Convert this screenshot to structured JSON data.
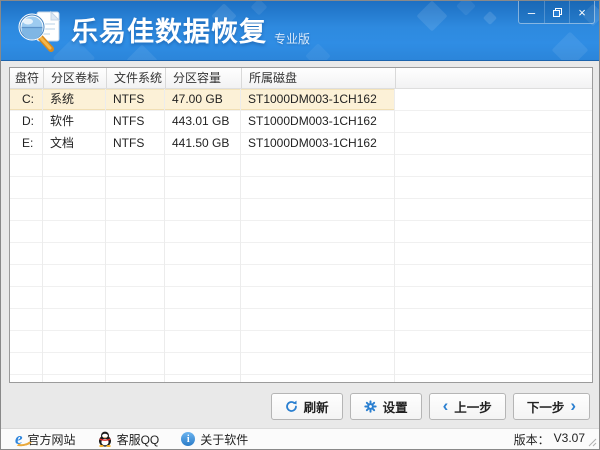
{
  "window": {
    "title": "乐易佳数据恢复",
    "edition": "专业版",
    "controls": {
      "minimize_glyph": "–",
      "restore_icon": "overlap-squares",
      "close_glyph": "×"
    }
  },
  "table": {
    "columns": [
      "盘符",
      "分区卷标",
      "文件系统",
      "分区容量",
      "所属磁盘"
    ],
    "rows": [
      {
        "drive": "C:",
        "label": "系统",
        "fs": "NTFS",
        "capacity": "47.00 GB",
        "disk": "ST1000DM003-1CH162",
        "selected": true
      },
      {
        "drive": "D:",
        "label": "软件",
        "fs": "NTFS",
        "capacity": "443.01 GB",
        "disk": "ST1000DM003-1CH162",
        "selected": false
      },
      {
        "drive": "E:",
        "label": "文档",
        "fs": "NTFS",
        "capacity": "441.50 GB",
        "disk": "ST1000DM003-1CH162",
        "selected": false
      }
    ]
  },
  "buttons": {
    "refresh": "刷新",
    "settings": "设置",
    "prev": "上一步",
    "next": "下一步",
    "prev_chevron": "‹",
    "next_chevron": "›"
  },
  "footer": {
    "website": "官方网站",
    "qq": "客服QQ",
    "about": "关于软件",
    "version_label": "版本：",
    "version": "V3.07",
    "info_glyph": "i",
    "ie_glyph": "e"
  },
  "icons": {
    "logo": "magnifier-over-document",
    "refresh": "circular-arrow",
    "settings": "gear",
    "qq": "penguin",
    "website": "ie-browser-e",
    "about": "info-circle",
    "resize": "diagonal-grip"
  },
  "colors": {
    "header_blue_top": "#1d6fc2",
    "header_blue": "#2e8adf",
    "accent_blue": "#2a7fd0",
    "selected_row_bg": "#fcf1d7",
    "selected_row_border": "#f3e3bb",
    "body_bg": "#e9e9e9",
    "table_border": "#9b9b9b",
    "handle_orange": "#e8962e"
  }
}
